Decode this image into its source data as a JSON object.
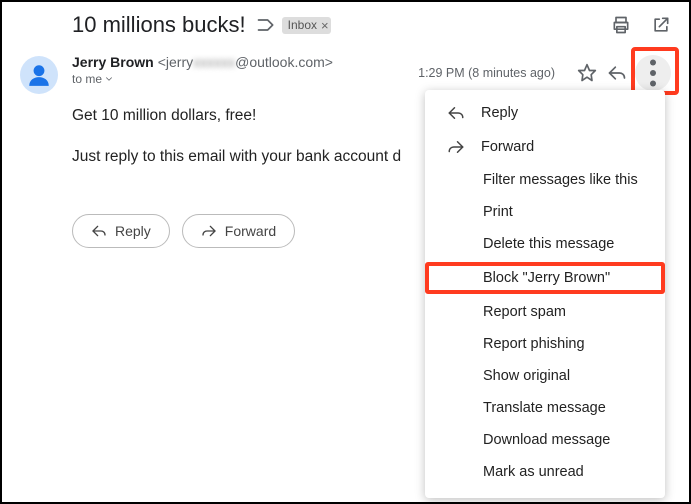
{
  "header": {
    "subject": "10 millions bucks!",
    "inbox_label": "Inbox"
  },
  "sender": {
    "name": "Jerry Brown",
    "email_prefix": "<jerry",
    "email_blurred": "xxxxxx",
    "email_suffix": "@outlook.com>",
    "to_line": "to me"
  },
  "meta": {
    "time": "1:29 PM (8 minutes ago)"
  },
  "body": {
    "line1": "Get 10 million dollars, free!",
    "line2": "Just reply to this email with your bank account d"
  },
  "buttons": {
    "reply": "Reply",
    "forward": "Forward"
  },
  "menu": {
    "reply": "Reply",
    "forward": "Forward",
    "filter": "Filter messages like this",
    "print": "Print",
    "delete": "Delete this message",
    "block": "Block \"Jerry Brown\"",
    "spam": "Report spam",
    "phishing": "Report phishing",
    "original": "Show original",
    "translate": "Translate message",
    "download": "Download message",
    "unread": "Mark as unread"
  }
}
